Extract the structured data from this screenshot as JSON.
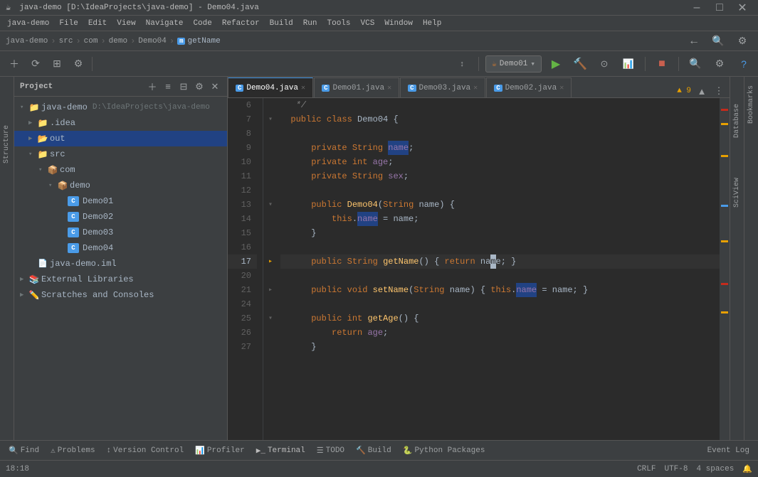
{
  "titleBar": {
    "title": "java-demo [D:\\IdeaProjects\\java-demo] - Demo04.java",
    "minLabel": "–",
    "maxLabel": "□",
    "closeLabel": "✕"
  },
  "menuBar": {
    "items": [
      "java-demo",
      "File",
      "Edit",
      "View",
      "Navigate",
      "Code",
      "Refactor",
      "Build",
      "Run",
      "Tools",
      "VCS",
      "Window",
      "Help"
    ]
  },
  "navBar": {
    "items": [
      "java-demo",
      "src",
      "com",
      "demo",
      "Demo04",
      "getName"
    ]
  },
  "toolbar": {
    "runConfig": "Demo01",
    "runLabel": "▶",
    "buildLabel": "🔨",
    "debugLabel": "🐛"
  },
  "projectPanel": {
    "title": "Project",
    "tree": [
      {
        "label": "java-demo",
        "path": "D:\\IdeaProjects\\java-demo",
        "type": "project",
        "indent": 0,
        "expanded": true
      },
      {
        "label": ".idea",
        "type": "folder",
        "indent": 1,
        "expanded": false
      },
      {
        "label": "out",
        "type": "folder-out",
        "indent": 1,
        "expanded": false,
        "selected": true
      },
      {
        "label": "src",
        "type": "folder-src",
        "indent": 1,
        "expanded": true
      },
      {
        "label": "com",
        "type": "folder-pkg",
        "indent": 2,
        "expanded": true
      },
      {
        "label": "demo",
        "type": "folder-pkg",
        "indent": 3,
        "expanded": true
      },
      {
        "label": "Demo01",
        "type": "java-class",
        "indent": 4
      },
      {
        "label": "Demo02",
        "type": "java-class",
        "indent": 4
      },
      {
        "label": "Demo03",
        "type": "java-class",
        "indent": 4
      },
      {
        "label": "Demo04",
        "type": "java-class",
        "indent": 4
      },
      {
        "label": "java-demo.iml",
        "type": "iml",
        "indent": 1
      },
      {
        "label": "External Libraries",
        "type": "ext-lib",
        "indent": 0,
        "expanded": false
      },
      {
        "label": "Scratches and Consoles",
        "type": "scratches",
        "indent": 0,
        "expanded": false
      }
    ]
  },
  "editorTabs": [
    {
      "label": "Demo04.java",
      "active": true,
      "icon": "C"
    },
    {
      "label": "Demo01.java",
      "active": false,
      "icon": "C"
    },
    {
      "label": "Demo03.java",
      "active": false,
      "icon": "C"
    },
    {
      "label": "Demo02.java",
      "active": false,
      "icon": "C"
    }
  ],
  "warningCount": "▲ 9",
  "codeLines": [
    {
      "num": 6,
      "content": "   */"
    },
    {
      "num": 7,
      "content": "  public class Demo04 {"
    },
    {
      "num": 8,
      "content": ""
    },
    {
      "num": 9,
      "content": "      private String name;"
    },
    {
      "num": 10,
      "content": "      private int age;"
    },
    {
      "num": 11,
      "content": "      private String sex;"
    },
    {
      "num": 12,
      "content": ""
    },
    {
      "num": 13,
      "content": "      public Demo04(String name) {"
    },
    {
      "num": 14,
      "content": "          this.name = name;"
    },
    {
      "num": 15,
      "content": "      }"
    },
    {
      "num": 16,
      "content": ""
    },
    {
      "num": 17,
      "content": "      public String getName() { return name; }"
    },
    {
      "num": 20,
      "content": ""
    },
    {
      "num": 21,
      "content": "      public void setName(String name) { this.name = name; }"
    },
    {
      "num": 24,
      "content": ""
    },
    {
      "num": 25,
      "content": "      public int getAge() {"
    },
    {
      "num": 26,
      "content": "          return age;"
    },
    {
      "num": 27,
      "content": "      }"
    }
  ],
  "statusBar": {
    "findLabel": "Find",
    "problemsLabel": "Problems",
    "vcsLabel": "Version Control",
    "profilerLabel": "Profiler",
    "terminalLabel": "Terminal",
    "todoLabel": "TODO",
    "buildLabel": "Build",
    "pythonLabel": "Python Packages",
    "eventLogLabel": "Event Log",
    "position": "18:18",
    "lineEnding": "CRLF",
    "encoding": "UTF-8",
    "indent": "4 spaces"
  },
  "sideLabels": {
    "database": "Database",
    "sciview": "SciView",
    "structure": "Structure",
    "bookmarks": "Bookmarks"
  }
}
